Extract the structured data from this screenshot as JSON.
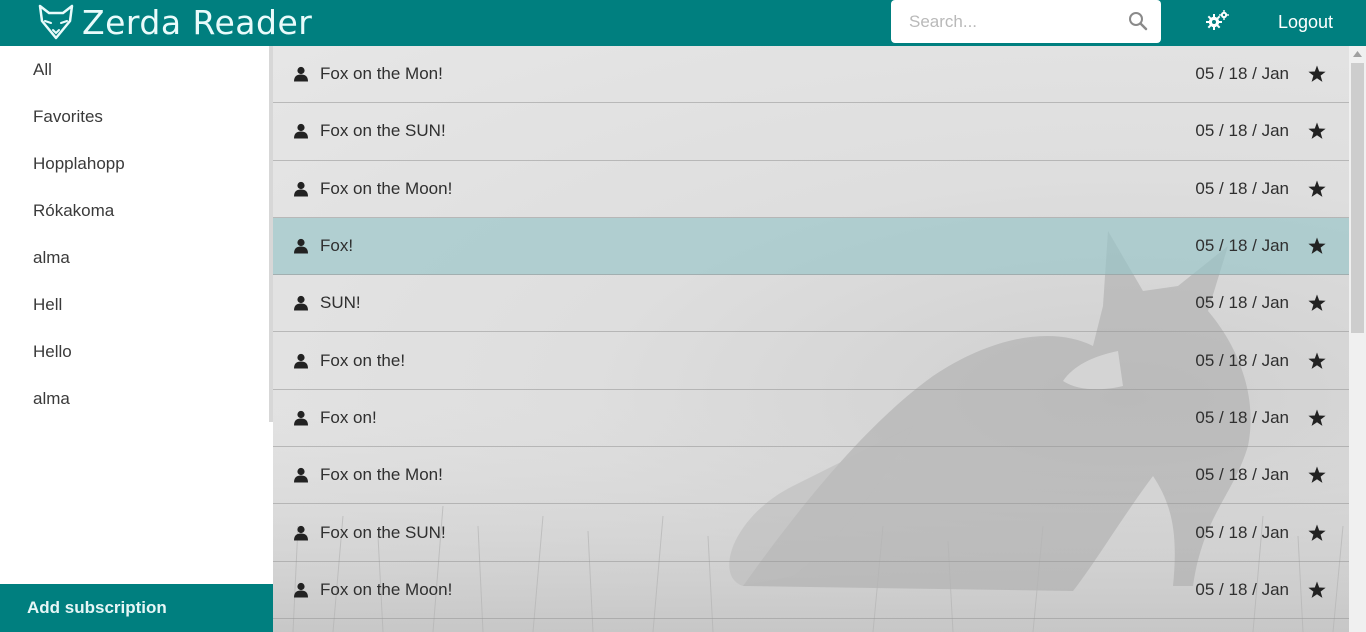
{
  "app": {
    "title": "Zerda Reader",
    "brand_color": "#007f7f"
  },
  "header": {
    "search_placeholder": "Search...",
    "logout_label": "Logout",
    "settings_icon": "gears-icon",
    "search_icon": "search-icon"
  },
  "sidebar": {
    "items": [
      {
        "label": "All"
      },
      {
        "label": "Favorites"
      },
      {
        "label": "Hopplahopp"
      },
      {
        "label": "Rókakoma"
      },
      {
        "label": "alma"
      },
      {
        "label": "Hell"
      },
      {
        "label": "Hello"
      },
      {
        "label": "alma"
      }
    ],
    "add_subscription_label": "Add subscription"
  },
  "feed": {
    "selected_color": "#96c4c8",
    "items": [
      {
        "title": "Fox on the Mon!",
        "date": "05 / 18 / Jan",
        "selected": false
      },
      {
        "title": "Fox on the SUN!",
        "date": "05 / 18 / Jan",
        "selected": false
      },
      {
        "title": "Fox on the Moon!",
        "date": "05 / 18 / Jan",
        "selected": false
      },
      {
        "title": "Fox!",
        "date": "05 / 18 / Jan",
        "selected": true
      },
      {
        "title": "SUN!",
        "date": "05 / 18 / Jan",
        "selected": false
      },
      {
        "title": "Fox on the!",
        "date": "05 / 18 / Jan",
        "selected": false
      },
      {
        "title": "Fox on!",
        "date": "05 / 18 / Jan",
        "selected": false
      },
      {
        "title": "Fox on the Mon!",
        "date": "05 / 18 / Jan",
        "selected": false
      },
      {
        "title": "Fox on the SUN!",
        "date": "05 / 18 / Jan",
        "selected": false
      },
      {
        "title": "Fox on the Moon!",
        "date": "05 / 18 / Jan",
        "selected": false
      }
    ]
  }
}
